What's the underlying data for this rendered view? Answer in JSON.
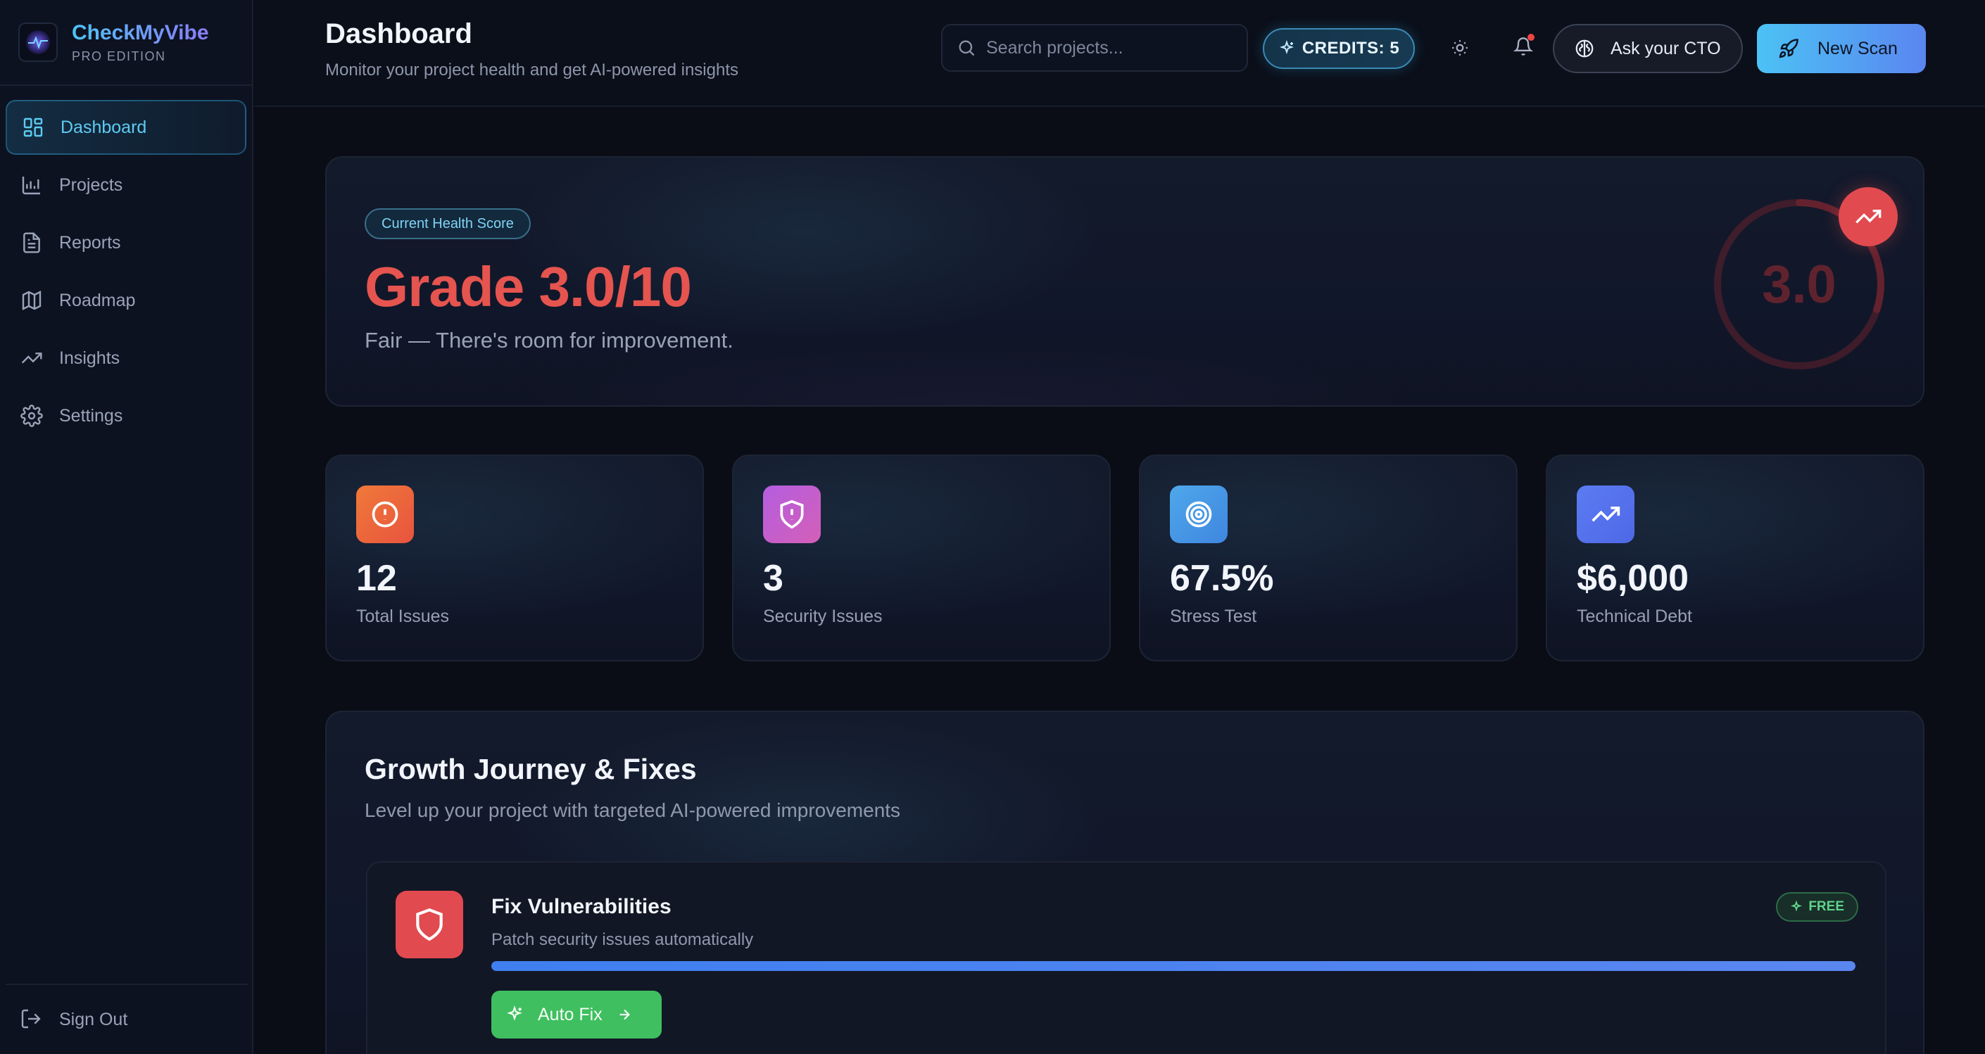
{
  "brand": {
    "name": "CheckMyVibe",
    "edition": "PRO EDITION"
  },
  "sidebar": {
    "items": [
      {
        "label": "Dashboard",
        "icon": "dashboard-grid-icon",
        "active": true
      },
      {
        "label": "Projects",
        "icon": "projects-chart-icon"
      },
      {
        "label": "Reports",
        "icon": "document-icon"
      },
      {
        "label": "Roadmap",
        "icon": "map-icon"
      },
      {
        "label": "Insights",
        "icon": "trending-up-icon"
      },
      {
        "label": "Settings",
        "icon": "gear-icon"
      }
    ],
    "signout_label": "Sign Out"
  },
  "header": {
    "title": "Dashboard",
    "subtitle": "Monitor your project health and get AI-powered insights",
    "search_placeholder": "Search projects...",
    "credits_label": "CREDITS: 5",
    "ask_cto_label": "Ask your CTO",
    "new_scan_label": "New Scan",
    "notification_dot": true
  },
  "health": {
    "badge": "Current Health Score",
    "grade": "Grade 3.0/10",
    "description": "Fair — There's room for improvement.",
    "gauge_value": "3.0",
    "score": 3.0,
    "max": 10
  },
  "stats": [
    {
      "value": "12",
      "label": "Total Issues",
      "icon": "alert-circle-icon",
      "color_from": "#f0793a",
      "color_to": "#e8543e"
    },
    {
      "value": "3",
      "label": "Security Issues",
      "icon": "shield-alert-icon",
      "color_from": "#b45ee0",
      "color_to": "#d45fb8"
    },
    {
      "value": "67.5%",
      "label": "Stress Test",
      "icon": "target-icon",
      "color_from": "#4ea8ea",
      "color_to": "#3f86e0"
    },
    {
      "value": "$6,000",
      "label": "Technical Debt",
      "icon": "trending-up-icon",
      "color_from": "#5b7cf2",
      "color_to": "#4f68e6"
    }
  ],
  "growth": {
    "title": "Growth Journey & Fixes",
    "subtitle": "Level up your project with targeted AI-powered improvements",
    "fixes": [
      {
        "title": "Fix Vulnerabilities",
        "description": "Patch security issues automatically",
        "badge": "FREE",
        "progress": 1.0,
        "action_label": "Auto Fix"
      }
    ]
  },
  "colors": {
    "accent_cyan": "#4fc3f7",
    "accent_blue": "#5a86f0",
    "danger": "#e14a4f",
    "success": "#3fbf5f",
    "background": "#0a0d16"
  }
}
